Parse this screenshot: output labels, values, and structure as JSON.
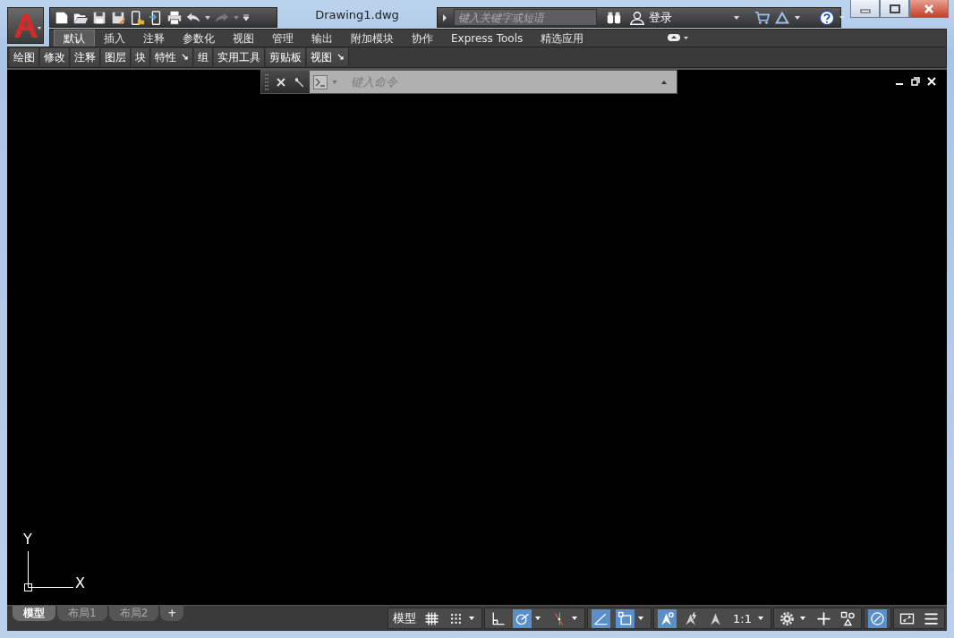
{
  "window": {
    "title": "Drawing1.dwg"
  },
  "search": {
    "placeholder": "键入关键字或短语"
  },
  "account": {
    "label": "登录"
  },
  "ribbon_tabs": [
    {
      "label": "默认",
      "selected": true
    },
    {
      "label": "插入",
      "selected": false
    },
    {
      "label": "注释",
      "selected": false
    },
    {
      "label": "参数化",
      "selected": false
    },
    {
      "label": "视图",
      "selected": false
    },
    {
      "label": "管理",
      "selected": false
    },
    {
      "label": "输出",
      "selected": false
    },
    {
      "label": "附加模块",
      "selected": false
    },
    {
      "label": "协作",
      "selected": false
    },
    {
      "label": "Express Tools",
      "selected": false
    },
    {
      "label": "精选应用",
      "selected": false
    }
  ],
  "ribbon_panels": [
    {
      "label": "绘图",
      "expander": false
    },
    {
      "label": "修改",
      "expander": false
    },
    {
      "label": "注释",
      "expander": false
    },
    {
      "label": "图层",
      "expander": false
    },
    {
      "label": "块",
      "expander": false
    },
    {
      "label": "特性",
      "expander": true
    },
    {
      "label": "组",
      "expander": false
    },
    {
      "label": "实用工具",
      "expander": false
    },
    {
      "label": "剪贴板",
      "expander": false
    },
    {
      "label": "视图",
      "expander": true
    }
  ],
  "command_line": {
    "placeholder": "键入命令"
  },
  "ucs": {
    "y_label": "Y",
    "x_label": "X"
  },
  "layout_tabs": [
    {
      "label": "模型",
      "selected": true
    },
    {
      "label": "布局1",
      "selected": false
    },
    {
      "label": "布局2",
      "selected": false
    }
  ],
  "add_layout": {
    "label": "+"
  },
  "status_bar": {
    "groups": [
      [
        {
          "kind": "label",
          "text": "模型"
        },
        {
          "kind": "grid",
          "on": false
        },
        {
          "kind": "snap",
          "on": false
        }
      ],
      [
        {
          "kind": "ortho",
          "on": false
        },
        {
          "kind": "polar",
          "on": true
        },
        {
          "kind": "isodraft",
          "on": false
        }
      ],
      [
        {
          "kind": "dynucs",
          "on": true
        },
        {
          "kind": "selection",
          "on": true
        }
      ],
      [
        {
          "kind": "annovis",
          "on": true
        },
        {
          "kind": "autoscale",
          "on": false
        },
        {
          "kind": "annoscale",
          "on": false
        },
        {
          "kind": "scale",
          "text": "1:1"
        }
      ],
      [
        {
          "kind": "workspace",
          "on": false
        },
        {
          "kind": "units",
          "on": false
        },
        {
          "kind": "isolate",
          "on": false
        }
      ],
      [
        {
          "kind": "hardware",
          "on": true
        }
      ],
      [
        {
          "kind": "fullscreen",
          "on": false
        },
        {
          "kind": "customize",
          "on": false
        }
      ]
    ]
  }
}
